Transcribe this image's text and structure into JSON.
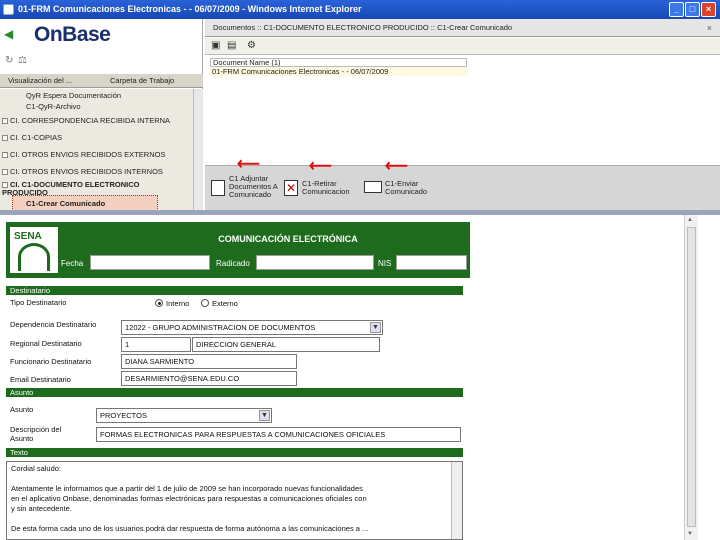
{
  "window": {
    "title": "01-FRM Comunicaciones Electronicas - - 06/07/2009 - Windows Internet Explorer"
  },
  "left": {
    "logo": "OnBase",
    "tabs": [
      "Visualización del ...",
      "Carpeta de Trabajo"
    ],
    "tree": [
      "QyR Espera Documentación",
      "C1-QyR-Archivo",
      "CI. CORRESPONDENCIA RECIBIDA INTERNA",
      "CI. C1-COPIAS",
      "CI. OTROS ENVIOS RECIBIDOS EXTERNOS",
      "CI. OTROS ENVIOS RECIBIDOS INTERNOS",
      "CI. C1-DOCUMENTO ELECTRONICO PRODUCIDO",
      "C1-Crear Comunicado"
    ]
  },
  "right": {
    "breadcrumb": "Documentos :: C1-DOCUMENTO ELECTRONICO PRODUCIDO :: C1-Crear Comunicado",
    "grid_header": "Document Name (1)",
    "grid_row": "01-FRM Comunicaciones Electronicas - - 06/07/2009",
    "tasks": [
      "C1 Adjuntar Documentos A Comunicado",
      "C1-Retirar Comunicacion",
      "C1-Enviar Comunicado"
    ]
  },
  "form": {
    "header_title": "COMUNICACIÓN ELECTRÓNICA",
    "sena": "SENA",
    "fecha_label": "Fecha",
    "radicado_label": "Radicado",
    "nis_label": "NIS",
    "destinatario_section": "Destinatario",
    "tipo_label": "Tipo Destinatario",
    "interno_label": "Interno",
    "externo_label": "Externo",
    "dependencia_label": "Dependencia Destinatario",
    "dependencia_value": "12022 - GRUPO ADMINISTRACION DE DOCUMENTOS",
    "regional_label": "Regional Destinatario",
    "regional_code": "1",
    "regional_value": "DIRECCION GENERAL",
    "funcionario_label": "Funcionario Destinatario",
    "funcionario_value": "DIANA SARMIENTO",
    "email_label": "Email Destinatario",
    "email_value": "DESARMIENTO@SENA.EDU.CO",
    "asunto_section": "Asunto",
    "asunto_label": "Asunto",
    "asunto_value": "PROYECTOS",
    "descripcion_label": "Descripción del Asunto",
    "descripcion_value": "FORMAS ELECTRONICAS PARA RESPUESTAS A COMUNICACIONES OFICIALES",
    "texto_section": "Texto",
    "texto_lines": [
      "Cordial saludo:",
      "",
      "Atentamente le informamos que a partir del 1 de julio de 2009 se han incorporado nuevas funcionalidades",
      "en el aplicativo Onbase, denominadas formas electrónicas para respuestas a comunicaciones oficiales con",
      "y sin antecedente.",
      "",
      "De esta forma cada uno de los usuarios podrá dar respuesta de forma autónoma a las comunicaciones a ..."
    ]
  }
}
